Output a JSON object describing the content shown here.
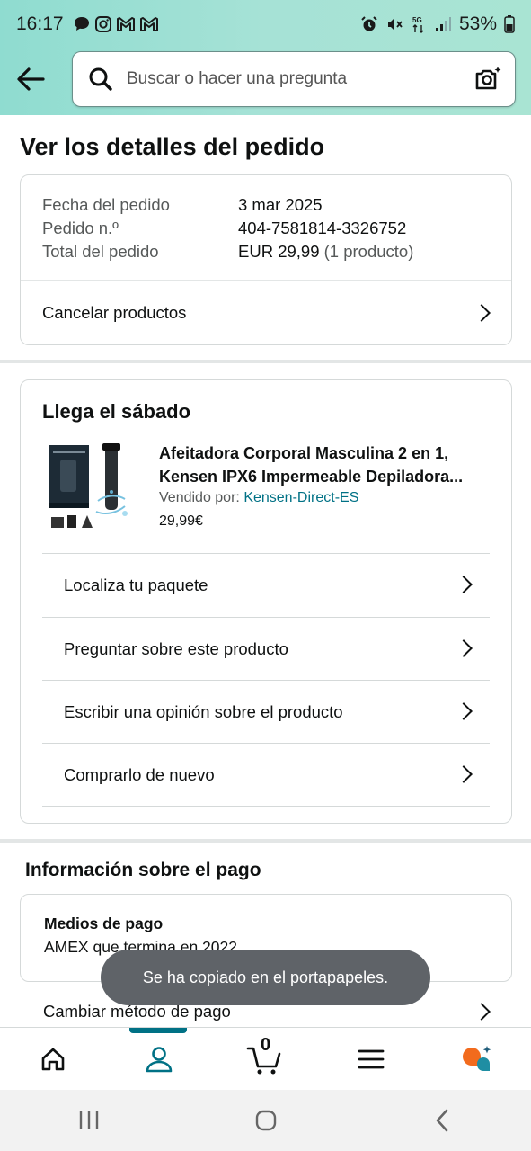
{
  "status_bar": {
    "time": "16:17",
    "battery": "53%",
    "network": "5G"
  },
  "search": {
    "placeholder": "Buscar o hacer una pregunta"
  },
  "page": {
    "title": "Ver los detalles del pedido"
  },
  "order_summary": {
    "date_label": "Fecha del pedido",
    "date_value": "3 mar 2025",
    "number_label": "Pedido n.º",
    "number_value": "404-7581814-3326752",
    "total_label": "Total del pedido",
    "total_value": "EUR 29,99",
    "total_count": "(1 producto)",
    "cancel_label": "Cancelar productos"
  },
  "delivery": {
    "heading": "Llega el sábado",
    "product": {
      "title": "Afeitadora Corporal Masculina 2 en 1, Kensen IPX6 Impermeable Depiladora...",
      "seller_label": "Vendido por:",
      "seller_name": "Kensen-Direct-ES",
      "price": "29,99€"
    },
    "actions": [
      {
        "label": "Localiza tu paquete"
      },
      {
        "label": "Preguntar sobre este producto"
      },
      {
        "label": "Escribir una opinión sobre el producto"
      },
      {
        "label": "Comprarlo de nuevo"
      }
    ]
  },
  "payment": {
    "heading": "Información sobre el pago",
    "methods_label": "Medios de pago",
    "methods_value": "AMEX  que termina en 2022",
    "change_label": "Cambiar método de pago"
  },
  "toast": {
    "message": "Se ha copiado en el portapapeles."
  },
  "bottom_nav": {
    "cart_count": "0",
    "accent_color": "#007185",
    "rufus_color": "#f26b1d"
  }
}
